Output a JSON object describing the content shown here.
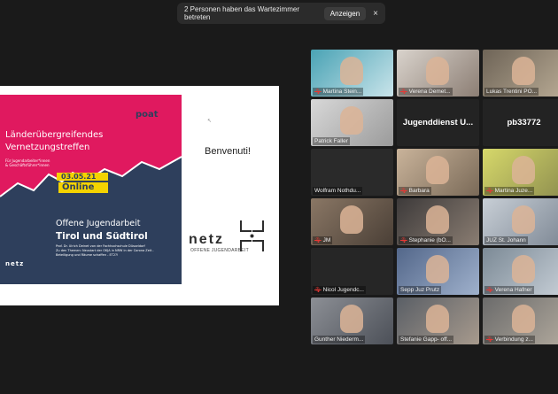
{
  "notification": {
    "message": "2 Personen haben das Wartezimmer betreten",
    "action_label": "Anzeigen",
    "close_symbol": "×"
  },
  "shared_screen": {
    "poster": {
      "title_line1": "Länderübergreifendes",
      "title_line2": "Vernetzungstreffen",
      "audience_line1": "Für Jugendarbeiter*innen",
      "audience_line2": "& Geschäftsführer*innen",
      "date": "03.05.21",
      "mode": "Online",
      "subtitle_line1": "Offene Jugendarbeit",
      "subtitle_line2": "Tirol und Südtirol",
      "speaker_line": "Prof. Dr. Ulrich Deinet von der Fachhochschule Düsseldorf",
      "topic_line1": "Zu den Themen: Neustart der OKJA in NRW in der Corona Zeit -",
      "topic_line2": "Beteiligung und Räume schaffen - ET2?!",
      "poat_logo": "poat",
      "netz_logo_small": "netz"
    },
    "greeting": "Benvenuti!",
    "netz_logo": "netz",
    "netz_tagline": "OFFENE JUGENDARBEIT"
  },
  "participants": [
    {
      "name": "Martina Stein...",
      "muted": true
    },
    {
      "name": "Verena Demet...",
      "muted": true
    },
    {
      "name": "Lukas Trentini PO...",
      "muted": false
    },
    {
      "name": "Patrick Faller",
      "muted": false
    },
    {
      "name": "Jugenddienst U...",
      "muted": false,
      "text_only": true
    },
    {
      "name": "pb33772",
      "muted": false,
      "text_only": true
    },
    {
      "name": "Wolfram Nothdu...",
      "muted": false
    },
    {
      "name": "Barbara",
      "muted": true
    },
    {
      "name": "Martina Juze...",
      "muted": true
    },
    {
      "name": "JM",
      "muted": true
    },
    {
      "name": "Stephanie (bO...",
      "muted": true
    },
    {
      "name": "JUZ St. Johann",
      "muted": false
    },
    {
      "name": "Nicol Jugendc...",
      "muted": true
    },
    {
      "name": "Sepp Juz Prutz",
      "muted": false
    },
    {
      "name": "Verena Hafner",
      "muted": true
    },
    {
      "name": "Gunther Niederm...",
      "muted": false
    },
    {
      "name": "Stefanie Gapp- off...",
      "muted": false
    },
    {
      "name": "Verbindung z...",
      "muted": true
    }
  ],
  "colors": {
    "background": "#1a1a1a",
    "poster_magenta": "#e0195f",
    "poster_navy": "#2e3f5c",
    "poster_yellow": "#f4d300",
    "mute_red": "#e53935"
  },
  "icons": {
    "mic_muted": "mic-muted-icon",
    "close": "close-icon"
  }
}
